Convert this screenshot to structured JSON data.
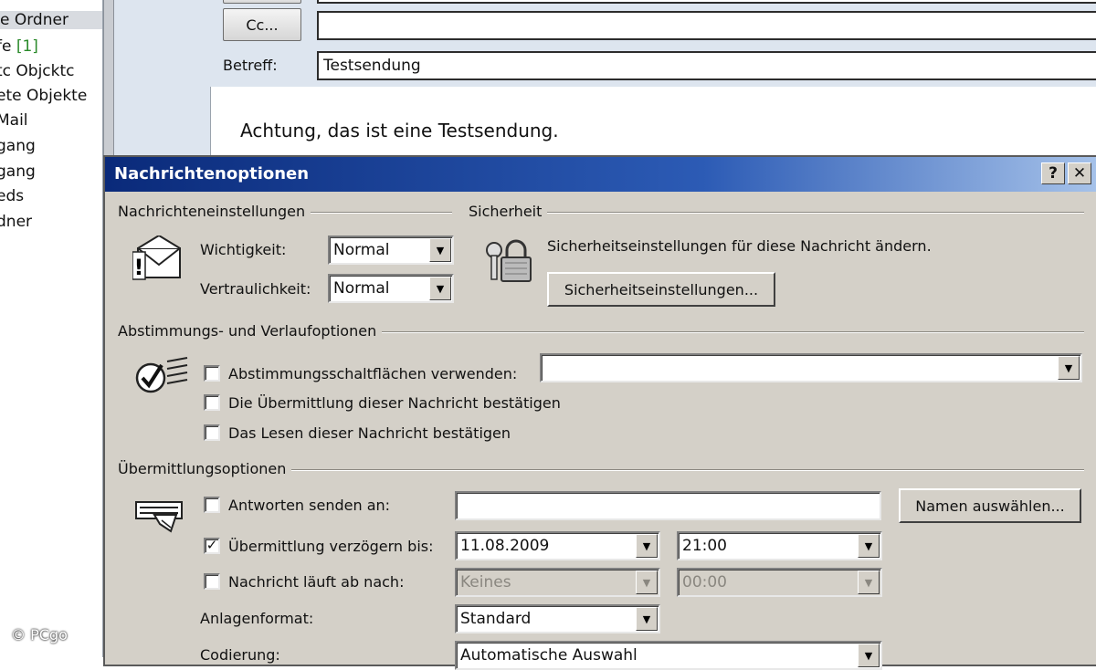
{
  "folders": [
    {
      "label": "e Ordner",
      "selected": true
    },
    {
      "label": "fe",
      "unread": "[1]"
    },
    {
      "label": "tc Objcktc"
    },
    {
      "label": "ete Objekte"
    },
    {
      "label": "Mail"
    },
    {
      "label": "gang"
    },
    {
      "label": "gang"
    },
    {
      "label": "eds"
    },
    {
      "label": "dner"
    }
  ],
  "compose": {
    "cc_label": "Cc...",
    "cc_value": "",
    "subject_label": "Betreff:",
    "subject_value": "Testsendung",
    "body_text": "Achtung, das ist eine Testsendung."
  },
  "dialog": {
    "title": "Nachrichtenoptionen",
    "help_label": "?",
    "close_label": "✕",
    "message_settings": {
      "heading": "Nachrichteneinstellungen",
      "importance_label": "Wichtigkeit:",
      "importance_value": "Normal",
      "sensitivity_label": "Vertraulichkeit:",
      "sensitivity_value": "Normal"
    },
    "security": {
      "heading": "Sicherheit",
      "text": "Sicherheitseinstellungen für diese Nachricht ändern.",
      "button_label": "Sicherheitseinstellungen..."
    },
    "voting": {
      "heading": "Abstimmungs- und Verlaufoptionen",
      "use_voting_label": "Abstimmungsschaltflächen verwenden:",
      "use_voting_value": "",
      "delivery_receipt_label": "Die Übermittlung dieser Nachricht bestätigen",
      "read_receipt_label": "Das Lesen dieser Nachricht bestätigen"
    },
    "delivery": {
      "heading": "Übermittlungsoptionen",
      "reply_to_label": "Antworten senden an:",
      "reply_to_value": "",
      "select_names_label": "Namen auswählen...",
      "delay_label": "Übermittlung verzögern bis:",
      "delay_checked": true,
      "delay_date": "11.08.2009",
      "delay_time": "21:00",
      "expires_label": "Nachricht läuft ab nach:",
      "expires_date": "Keines",
      "expires_time": "00:00",
      "attachment_format_label": "Anlagenformat:",
      "attachment_format_value": "Standard",
      "encoding_label": "Codierung:",
      "encoding_value": "Automatische Auswahl"
    }
  },
  "watermark": "© PCgo",
  "colors": {
    "titlebar_start": "#0a2a7a",
    "titlebar_end": "#a7c3ea",
    "dialog_bg": "#d4d0c8",
    "unread_green": "#2a8a2a"
  },
  "icons": {
    "importance": "envelope-exclamation-icon",
    "security": "padlock-keys-icon",
    "voting": "checkmark-voting-icon",
    "delivery": "delivery-envelope-icon",
    "dropdown": "chevron-down-icon"
  }
}
